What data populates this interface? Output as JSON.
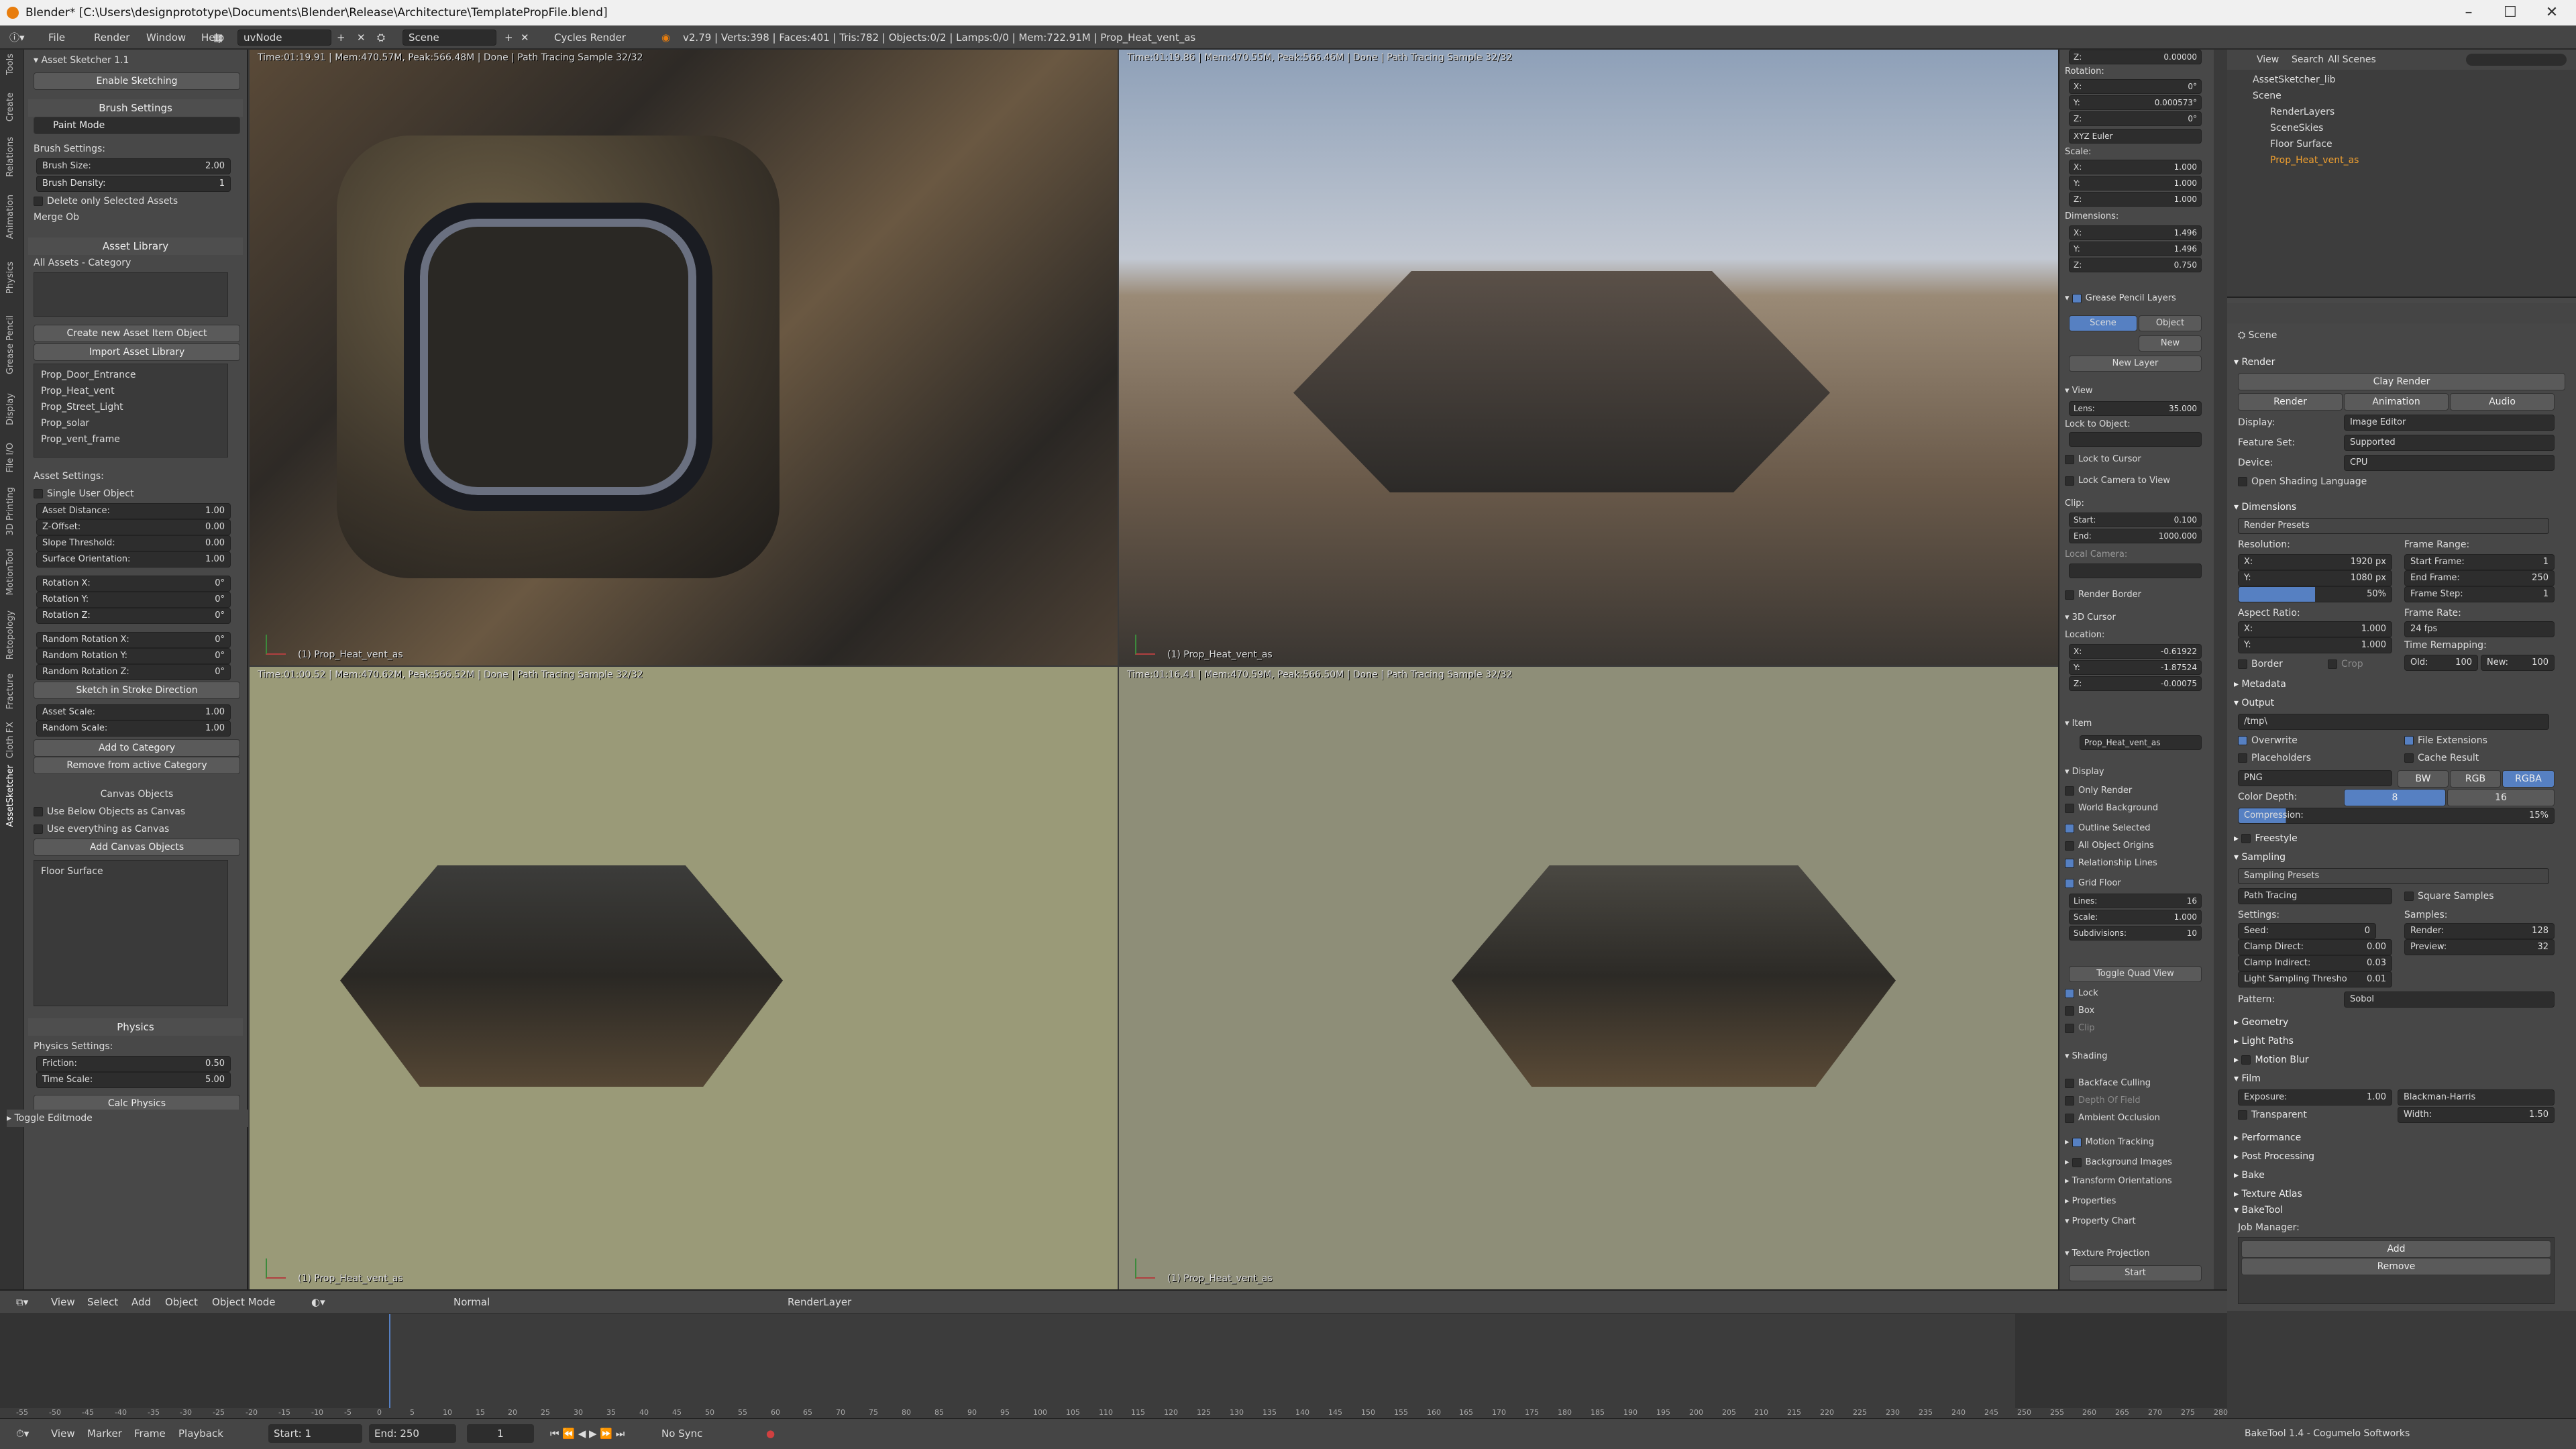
{
  "window": {
    "title": "Blender* [C:\\Users\\designprototype\\Documents\\Blender\\Release\\Architecture\\TemplatePropFile.blend]",
    "minimize": "–",
    "maximize": "☐",
    "close": "✕"
  },
  "infobar": {
    "menus": [
      "File",
      "Render",
      "Window",
      "Help"
    ],
    "layout": "uvNode",
    "scene": "Scene",
    "engine": "Cycles Render",
    "stats": "v2.79 | Verts:398 | Faces:401 | Tris:782 | Objects:0/2 | Lamps:0/0 | Mem:722.91M | Prop_Heat_vent_as"
  },
  "left_tabs": [
    "Tools",
    "Create",
    "Relations",
    "Animation",
    "Physics",
    "Grease Pencil",
    "Display",
    "File I/O",
    "3D Printing",
    "MotionTool",
    "Retopology",
    "Fracture",
    "Cloth FX",
    "AssetSketcher"
  ],
  "left": {
    "title": "Asset Sketcher 1.1",
    "enable_sketching": "Enable Sketching",
    "brush_settings": "Brush Settings",
    "paint_mode": "Paint Mode",
    "brush_settings_label": "Brush Settings:",
    "brush_size_label": "Brush Size:",
    "brush_size": "2.00",
    "brush_density_label": "Brush Density:",
    "brush_density": "1",
    "delete_only_selected": "Delete only Selected Assets",
    "merge_ob": "Merge Ob",
    "asset_library": "Asset Library",
    "category": "All Assets - Category",
    "create_new_asset": "Create new Asset Item Object",
    "import_asset_library": "Import Asset Library",
    "assets": [
      "Prop_Door_Entrance",
      "Prop_Heat_vent",
      "Prop_Street_Light",
      "Prop_solar",
      "Prop_vent_frame"
    ],
    "asset_settings": "Asset Settings:",
    "single_user_object": "Single User Object",
    "fields": [
      {
        "label": "Asset Distance:",
        "value": "1.00"
      },
      {
        "label": "Z-Offset:",
        "value": "0.00"
      },
      {
        "label": "Slope Threshold:",
        "value": "0.00"
      },
      {
        "label": "Surface Orientation:",
        "value": "1.00"
      },
      {
        "label": "Rotation X:",
        "value": "0°"
      },
      {
        "label": "Rotation Y:",
        "value": "0°"
      },
      {
        "label": "Rotation Z:",
        "value": "0°"
      },
      {
        "label": "Random Rotation X:",
        "value": "0°"
      },
      {
        "label": "Random Rotation Y:",
        "value": "0°"
      },
      {
        "label": "Random Rotation Z:",
        "value": "0°"
      }
    ],
    "sketch_in_stroke": "Sketch in Stroke Direction",
    "asset_scale_label": "Asset Scale:",
    "asset_scale": "1.00",
    "random_scale_label": "Random Scale:",
    "random_scale": "1.00",
    "add_to_category": "Add to Category",
    "remove_from_category": "Remove from active Category",
    "canvas_objects": "Canvas Objects",
    "use_below_canvas": "Use Below Objects as Canvas",
    "use_everything_canvas": "Use everything as Canvas",
    "add_canvas_objects": "Add Canvas Objects",
    "floor_surface": "Floor Surface",
    "physics": "Physics",
    "physics_settings": "Physics Settings:",
    "friction_label": "Friction:",
    "friction": "0.50",
    "time_scale_label": "Time Scale:",
    "time_scale": "5.00",
    "calc_physics": "Calc Physics",
    "toggle_editmode": "Toggle Editmode"
  },
  "viewports": [
    {
      "stat": "Time:01:19.91 | Mem:470.57M, Peak:566.48M | Done | Path Tracing Sample 32/32",
      "name": "(1) Prop_Heat_vent_as"
    },
    {
      "stat": "Time:01:19.86 | Mem:470.55M, Peak:566.46M | Done | Path Tracing Sample 32/32",
      "name": "(1) Prop_Heat_vent_as"
    },
    {
      "stat": "Time:01:00.52 | Mem:470.62M, Peak:566.52M | Done | Path Tracing Sample 32/32",
      "name": "(1) Prop_Heat_vent_as"
    },
    {
      "stat": "Time:01:16.41 | Mem:470.59M, Peak:566.50M | Done | Path Tracing Sample 32/32",
      "name": "(1) Prop_Heat_vent_as"
    }
  ],
  "npanel": {
    "z_top": "0.00000",
    "rotation": "Rotation:",
    "rot_x": "0°",
    "rot_y": "0.000573°",
    "rot_z": "0°",
    "rot_mode": "XYZ Euler",
    "scale": "Scale:",
    "scale_x": "1.000",
    "scale_y": "1.000",
    "scale_z": "1.000",
    "dimensions": "Dimensions:",
    "dim_x": "1.496",
    "dim_y": "1.496",
    "dim_z": "0.750",
    "grease_pencil_layers": "Grease Pencil Layers",
    "scene_tab": "Scene",
    "object_tab": "Object",
    "new": "New",
    "new_layer": "New Layer",
    "view": "View",
    "lens_label": "Lens:",
    "lens": "35.000",
    "lock_to_object": "Lock to Object:",
    "lock_to_cursor": "Lock to Cursor",
    "lock_camera": "Lock Camera to View",
    "clip": "Clip:",
    "clip_start_label": "Start:",
    "clip_start": "0.100",
    "clip_end_label": "End:",
    "clip_end": "1000.000",
    "local_camera": "Local Camera:",
    "render_border": "Render Border",
    "cursor_3d": "3D Cursor",
    "location": "Location:",
    "cur_x": "-0.61922",
    "cur_y": "-1.87524",
    "cur_z": "-0.00075",
    "item": "Item",
    "item_name": "Prop_Heat_vent_as",
    "display": "Display",
    "only_render": "Only Render",
    "world_background": "World Background",
    "outline_selected": "Outline Selected",
    "all_object_origins": "All Object Origins",
    "relationship_lines": "Relationship Lines",
    "grid_floor": "Grid Floor",
    "lines_label": "Lines:",
    "lines": "16",
    "grid_scale_label": "Scale:",
    "grid_scale": "1.000",
    "subdiv_label": "Subdivisions:",
    "subdiv": "10",
    "toggle_quad_view": "Toggle Quad View",
    "lock": "Lock",
    "box": "Box",
    "clip2": "Clip",
    "shading": "Shading",
    "backface_culling": "Backface Culling",
    "depth_of_field": "Depth Of Field",
    "ambient_occlusion": "Ambient Occlusion",
    "motion_tracking": "Motion Tracking",
    "background_images": "Background Images",
    "transform_orientations": "Transform Orientations",
    "properties": "Properties",
    "property_chart": "Property Chart",
    "texture_projection": "Texture Projection",
    "start": "Start"
  },
  "outliner": {
    "view": "View",
    "search": "Search",
    "all_scenes": "All Scenes",
    "items": [
      "AssetSketcher_lib",
      "Scene",
      "RenderLayers",
      "SceneSkies",
      "Floor Surface",
      "Prop_Heat_vent_as"
    ]
  },
  "props": {
    "scene": "Scene",
    "render": "Render",
    "clay_render": "Clay Render",
    "render_btn": "Render",
    "animation_btn": "Animation",
    "audio_btn": "Audio",
    "display_label": "Display:",
    "display_val": "Image Editor",
    "feature_label": "Feature Set:",
    "feature_val": "Supported",
    "device_label": "Device:",
    "device_val": "CPU",
    "osl": "Open Shading Language",
    "dimensions": "Dimensions",
    "render_presets": "Render Presets",
    "resolution": "Resolution:",
    "res_x": "1920 px",
    "res_y": "1080 px",
    "res_pct": "50%",
    "frame_range": "Frame Range:",
    "start_frame": "Start Frame:",
    "start_frame_v": "1",
    "end_frame": "End Frame:",
    "end_frame_v": "250",
    "frame_step": "Frame Step:",
    "frame_step_v": "1",
    "aspect": "Aspect Ratio:",
    "asp_x": "1.000",
    "asp_y": "1.000",
    "frame_rate": "Frame Rate:",
    "fps": "24 fps",
    "time_remap": "Time Remapping:",
    "old": "Old:",
    "old_v": "100",
    "new": "New:",
    "new_v": "100",
    "border": "Border",
    "crop": "Crop",
    "metadata": "Metadata",
    "output": "Output",
    "output_path": "/tmp\\",
    "overwrite": "Overwrite",
    "file_extensions": "File Extensions",
    "placeholders": "Placeholders",
    "cache_result": "Cache Result",
    "format": "PNG",
    "bw": "BW",
    "rgb": "RGB",
    "rgba": "RGBA",
    "color_depth": "Color Depth:",
    "depth_8": "8",
    "depth_16": "16",
    "compression": "Compression:",
    "compression_v": "15%",
    "freestyle": "Freestyle",
    "sampling": "Sampling",
    "sampling_presets": "Sampling Presets",
    "path_tracing": "Path Tracing",
    "square_samples": "Square Samples",
    "settings": "Settings:",
    "samples": "Samples:",
    "seed": "Seed:",
    "seed_v": "0",
    "render_s": "Render:",
    "render_s_v": "128",
    "clamp_direct": "Clamp Direct:",
    "clamp_direct_v": "0.00",
    "preview_s": "Preview:",
    "preview_s_v": "32",
    "clamp_indirect": "Clamp Indirect:",
    "clamp_indirect_v": "0.03",
    "light_thresh": "Light Sampling Thresho",
    "light_thresh_v": "0.01",
    "pattern": "Pattern:",
    "pattern_v": "Sobol",
    "geometry": "Geometry",
    "light_paths": "Light Paths",
    "motion_blur": "Motion Blur",
    "film": "Film",
    "exposure": "Exposure:",
    "exposure_v": "1.00",
    "filter": "Blackman-Harris",
    "transparent": "Transparent",
    "width": "Width:",
    "width_v": "1.50",
    "performance": "Performance",
    "post_processing": "Post Processing",
    "bake": "Bake",
    "texture_atlas": "Texture Atlas",
    "baketool": "BakeTool",
    "job_manager": "Job Manager:",
    "add": "Add",
    "remove": "Remove",
    "footer": "BakeTool 1.4 - Cogumelo Softworks"
  },
  "vpheader": {
    "view": "View",
    "select": "Select",
    "add": "Add",
    "object": "Object",
    "mode": "Object Mode",
    "pivot": "Normal",
    "layer": "RenderLayer"
  },
  "timeline": {
    "view": "View",
    "marker": "Marker",
    "frame": "Frame",
    "playback": "Playback",
    "start_label": "Start:",
    "start": "1",
    "end_label": "End:",
    "end": "250",
    "current": "1",
    "sync": "No Sync",
    "ticks": [
      "-55",
      "-50",
      "-45",
      "-40",
      "-35",
      "-30",
      "-25",
      "-20",
      "-15",
      "-10",
      "-5",
      "0",
      "5",
      "10",
      "15",
      "20",
      "25",
      "30",
      "35",
      "40",
      "45",
      "50",
      "55",
      "60",
      "65",
      "70",
      "75",
      "80",
      "85",
      "90",
      "95",
      "100",
      "105",
      "110",
      "115",
      "120",
      "125",
      "130",
      "135",
      "140",
      "145",
      "150",
      "155",
      "160",
      "165",
      "170",
      "175",
      "180",
      "185",
      "190",
      "195",
      "200",
      "205",
      "210",
      "215",
      "220",
      "225",
      "230",
      "235",
      "240",
      "245",
      "250",
      "255",
      "260",
      "265",
      "270",
      "275",
      "280"
    ]
  },
  "colors": {
    "accent": "#5680c2",
    "blender_orange": "#e87d0d",
    "selected_text": "#f0a030"
  }
}
